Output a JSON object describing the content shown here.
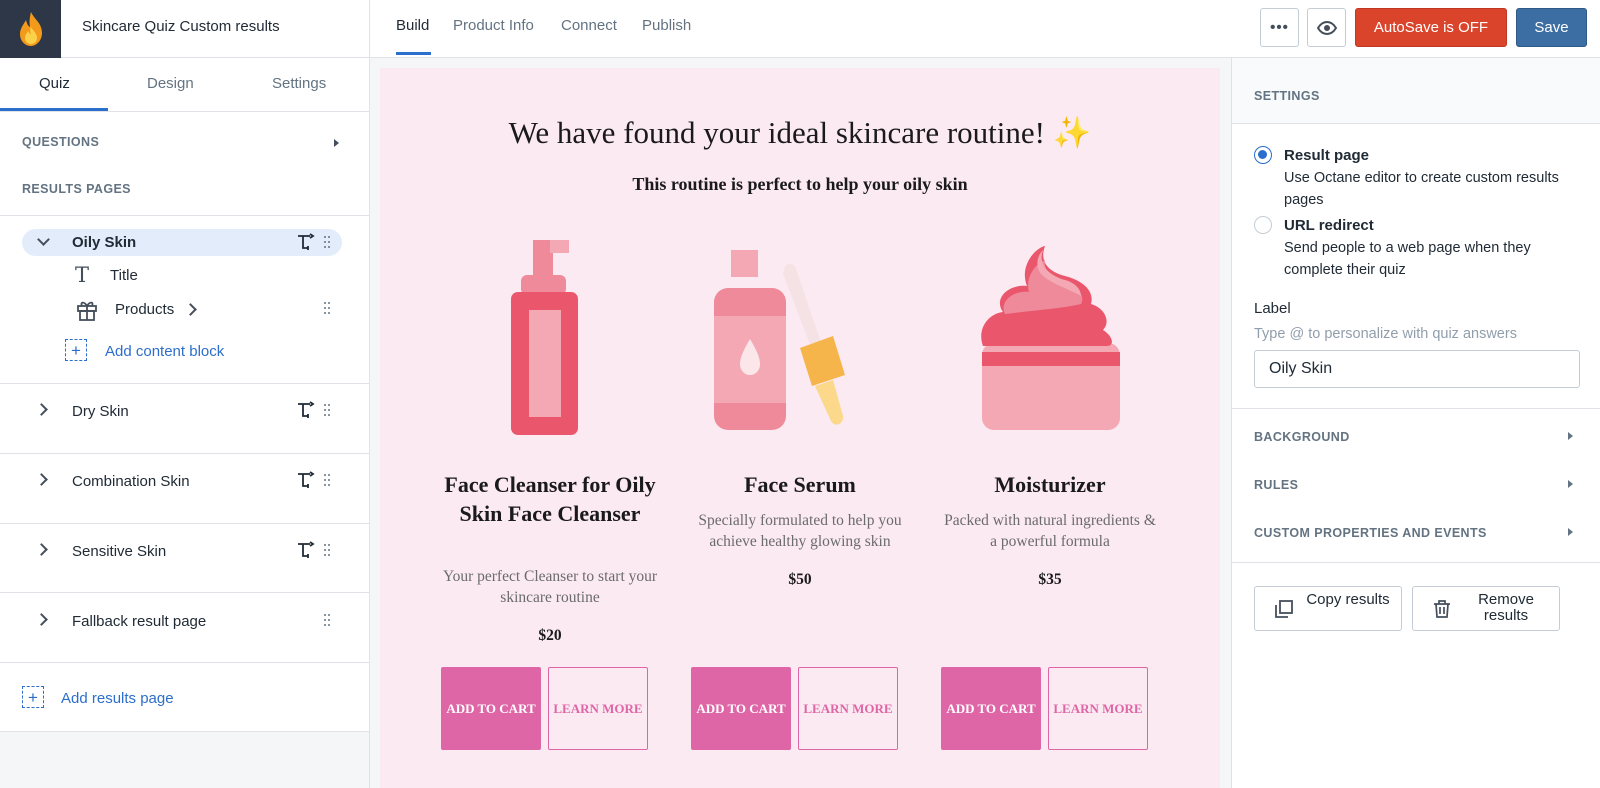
{
  "app": {
    "title": "Skincare Quiz Custom results"
  },
  "top_tabs": [
    {
      "label": "Build",
      "active": true
    },
    {
      "label": "Product Info",
      "active": false
    },
    {
      "label": "Connect",
      "active": false
    },
    {
      "label": "Publish",
      "active": false
    }
  ],
  "toolbar": {
    "more_label": "•••",
    "autosave_label": "AutoSave is OFF",
    "save_label": "Save"
  },
  "left_tabs": [
    {
      "label": "Quiz",
      "active": true
    },
    {
      "label": "Design",
      "active": false
    },
    {
      "label": "Settings",
      "active": false
    }
  ],
  "sidebar": {
    "questions_heading": "QUESTIONS",
    "results_heading": "RESULTS PAGES",
    "active_page": {
      "label": "Oily Skin",
      "blocks": [
        {
          "label": "Title",
          "icon": "text-icon"
        },
        {
          "label": "Products",
          "icon": "gift-icon"
        }
      ]
    },
    "add_block_label": "Add content block",
    "pages": [
      {
        "label": "Dry Skin"
      },
      {
        "label": "Combination Skin"
      },
      {
        "label": "Sensitive Skin"
      },
      {
        "label": "Fallback result page"
      }
    ],
    "add_page_label": "Add results page"
  },
  "canvas": {
    "headline": "We have found your ideal skincare routine! ✨",
    "subheadline": "This routine is perfect to help your oily skin",
    "products": [
      {
        "name": "Face Cleanser for Oily Skin Face Cleanser",
        "description": "Your perfect Cleanser to start your skincare routine",
        "price": "$20",
        "cart_label": "ADD TO CART",
        "learn_label": "LEARN MORE"
      },
      {
        "name": "Face Serum",
        "description": "Specially formulated to help you achieve healthy glowing skin",
        "price": "$50",
        "cart_label": "ADD TO CART",
        "learn_label": "LEARN MORE"
      },
      {
        "name": "Moisturizer",
        "description": "Packed with natural ingredients & a powerful formula",
        "price": "$35",
        "cart_label": "ADD TO CART",
        "learn_label": "LEARN MORE"
      }
    ]
  },
  "settings": {
    "heading": "SETTINGS",
    "options": [
      {
        "title": "Result page",
        "description": "Use Octane editor to create custom results pages",
        "selected": true
      },
      {
        "title": "URL redirect",
        "description": "Send people to a web page when they complete their quiz",
        "selected": false
      }
    ],
    "label_title": "Label",
    "label_hint": "Type @ to personalize with quiz answers",
    "label_value": "Oily Skin",
    "accordions": [
      "BACKGROUND",
      "RULES",
      "CUSTOM PROPERTIES AND EVENTS"
    ],
    "copy_label": "Copy results",
    "remove_label": "Remove results"
  },
  "colors": {
    "accent": "#2c6ecb",
    "autosave": "#d9442b",
    "save": "#3d6ea3",
    "canvas_bg": "#fbeaf2",
    "product_button": "#df66a6"
  }
}
